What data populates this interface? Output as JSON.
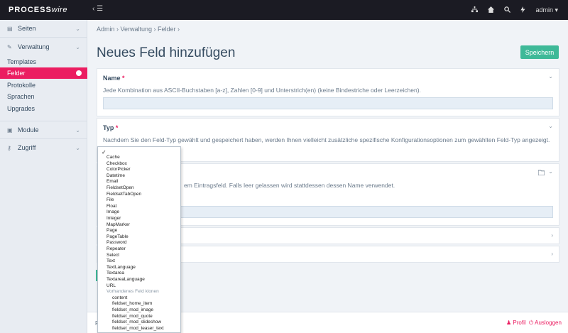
{
  "app": {
    "logo_strong": "PROCESS",
    "logo_light": "wire",
    "menu_toggle": "‹ ☰",
    "user": "admin ▾"
  },
  "sidebar": {
    "items": [
      {
        "label": "Seiten",
        "icon": "file-icon"
      },
      {
        "label": "Verwaltung",
        "icon": "wrench-icon"
      },
      {
        "label": "Module",
        "icon": "plug-icon"
      },
      {
        "label": "Zugriff",
        "icon": "key-icon"
      }
    ],
    "sub_items": [
      "Templates",
      "Felder",
      "Protokolle",
      "Sprachen",
      "Upgrades"
    ]
  },
  "breadcrumb": "Admin  ›  Verwaltung  ›  Felder  ›",
  "page_title": "Neues Feld hinzufügen",
  "save_label": "Speichern",
  "panels": {
    "name_label": "Name",
    "name_desc": "Jede Kombination aus ASCII-Buchstaben [a-z], Zahlen [0-9] und Unterstrich(en) (keine Bindestriche oder Leerzeichen).",
    "type_label": "Typ",
    "type_desc": "Nachdem Sie den Feld-Typ gewählt und gespeichert haben, werden Ihnen vielleicht zusätzliche spezifische Konfigurationsoptionen zum gewählten Feld-Typ angezeigt.",
    "label_desc": "em Eintragsfeld. Falls leer gelassen wird stattdessen dessen Name verwendet."
  },
  "required_mark": "*",
  "footer": {
    "left": "P",
    "profile": "Profil",
    "logout": "Ausloggen"
  },
  "dropdown": {
    "checkmark": "✓",
    "options": [
      "Cache",
      "Checkbox",
      "ColorPicker",
      "Datetime",
      "Email",
      "FieldsetOpen",
      "FieldsetTabOpen",
      "File",
      "Float",
      "Image",
      "Integer",
      "MapMarker",
      "Page",
      "PageTable",
      "Password",
      "Repeater",
      "Select",
      "Text",
      "TextLanguage",
      "Textarea",
      "TextareaLanguage",
      "URL"
    ],
    "group_label": "Vorhandenes Feld klonen",
    "clone_options": [
      "content",
      "fieldset_home_item",
      "fieldset_mod_image",
      "fieldset_mod_quote",
      "fieldset_mod_slideshow",
      "fieldset_mod_teaser_text"
    ]
  },
  "colors": {
    "accent": "#eb1d61",
    "save": "#3eb998",
    "topbar": "#1b1b23"
  }
}
